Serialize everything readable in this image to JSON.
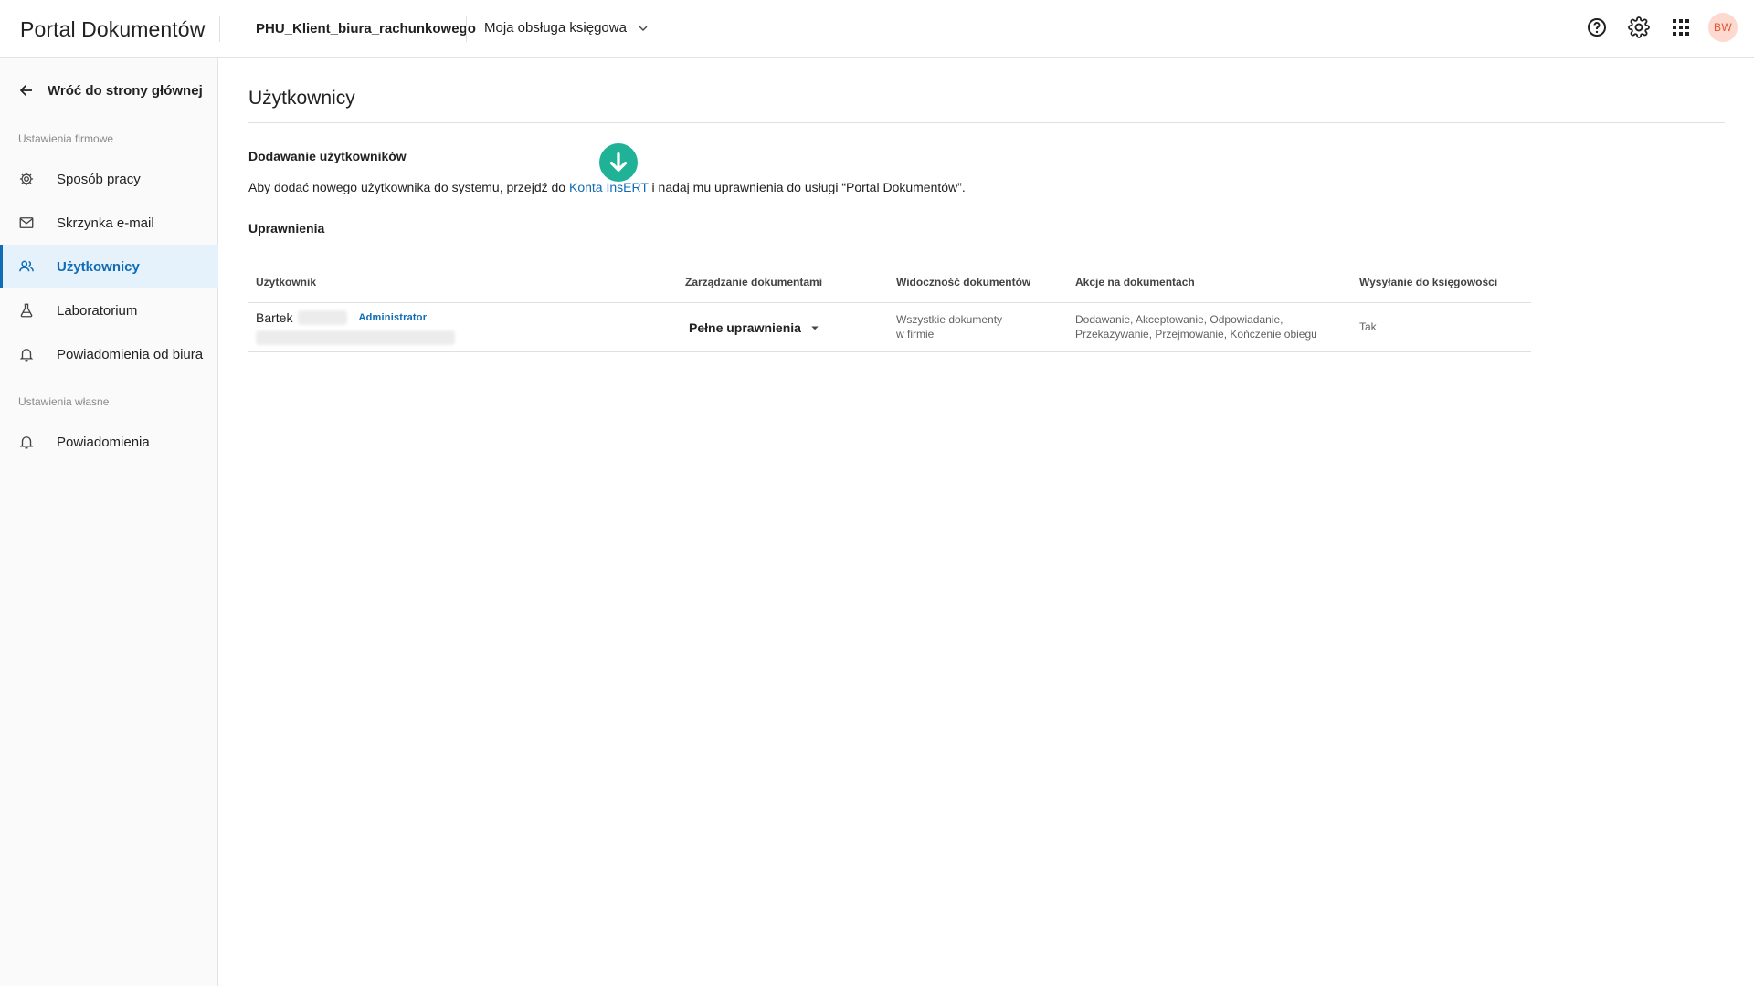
{
  "header": {
    "app_title": "Portal Dokumentów",
    "company": "PHU_Klient_biura_rachunkowego",
    "service": "Moja obsługa księgowa",
    "avatar_initials": "BW",
    "icons": [
      "help-icon",
      "settings-icon",
      "apps-grid-icon"
    ]
  },
  "sidebar": {
    "back_label": "Wróć do strony głównej",
    "section_company": "Ustawienia firmowe",
    "items": [
      {
        "label": "Sposób pracy",
        "icon": "gear-icon"
      },
      {
        "label": "Skrzynka e-mail",
        "icon": "mail-icon"
      },
      {
        "label": "Użytkownicy",
        "icon": "users-icon",
        "active": true
      },
      {
        "label": "Laboratorium",
        "icon": "flask-icon"
      },
      {
        "label": "Powiadomienia od biura",
        "icon": "bell-icon"
      }
    ],
    "section_own": "Ustawienia własne",
    "own_items": [
      {
        "label": "Powiadomienia",
        "icon": "bell-icon"
      }
    ]
  },
  "main": {
    "title": "Użytkownicy",
    "add_heading": "Dodawanie użytkowników",
    "info_before": "Aby dodać nowego użytkownika do systemu, przejdź do ",
    "info_link": "Konta InsERT",
    "info_after": " i nadaj mu uprawnienia do usługi “Portal Dokumentów”.",
    "permissions_heading": "Uprawnienia",
    "accent_color": "#0f6cb5",
    "marker_color": "#20b296"
  },
  "table": {
    "columns": [
      "Użytkownik",
      "Zarządzanie dokumentami",
      "Widoczność dokumentów",
      "Akcje na dokumentach",
      "Wysyłanie do księgowości"
    ],
    "rows": [
      {
        "first_name": "Bartek",
        "role": "Administrator",
        "management": "Pełne uprawnienia",
        "visibility_line1": "Wszystkie dokumenty",
        "visibility_line2": "w firmie",
        "actions_line1": "Dodawanie, Akceptowanie, Odpowiadanie,",
        "actions_line2": "Przekazywanie, Przejmowanie, Kończenie obiegu",
        "send_to_accounting": "Tak"
      }
    ]
  }
}
